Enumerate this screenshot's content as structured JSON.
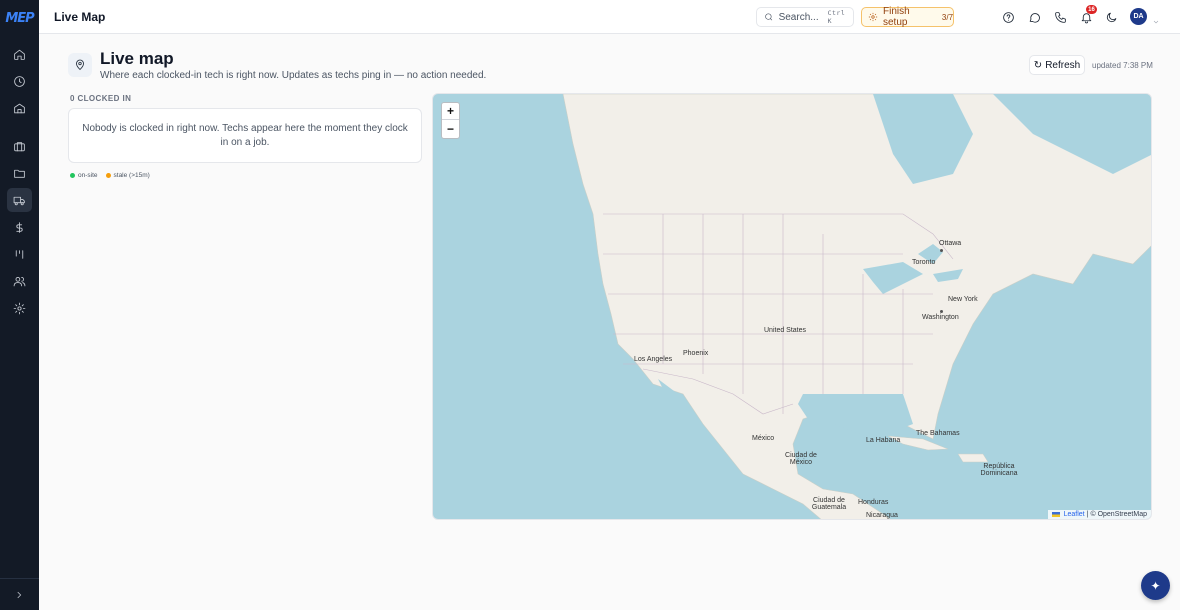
{
  "app": {
    "logo_text": "MEP",
    "title": "Live Map"
  },
  "topbar": {
    "search_placeholder": "Search...",
    "search_shortcut": "Ctrl K",
    "finish_setup_label": "Finish setup",
    "finish_setup_progress": "3/7",
    "notification_count": "16",
    "avatar_initials": "DA"
  },
  "page": {
    "title": "Live map",
    "subtitle": "Where each clocked-in tech is right now. Updates as techs ping in — no action needed.",
    "refresh_label": "Refresh",
    "updated_text": "updated 7:38 PM"
  },
  "clocked": {
    "label": "0 CLOCKED IN",
    "empty_message": "Nobody is clocked in right now. Techs appear here the moment they clock in on a job."
  },
  "legend": [
    {
      "label": "on-site",
      "color": "#22c55e"
    },
    {
      "label": "stale (>15m)",
      "color": "#f59e0b"
    }
  ],
  "map": {
    "zoom_in": "+",
    "zoom_out": "−",
    "attribution_leaflet": "Leaflet",
    "attribution_separator": "|",
    "attribution_osm": "© OpenStreetMap",
    "labels": {
      "ottawa": "Ottawa",
      "toronto": "Toronto",
      "new_york": "New York",
      "washington": "Washington",
      "united_states": "United States",
      "phoenix": "Phoenix",
      "los_angeles": "Los Angeles",
      "la_habana": "La Habana",
      "the_bahamas": "The Bahamas",
      "mexico": "México",
      "ciudad_de_mexico": "Ciudad de México",
      "republica_dominicana": "República Dominicana",
      "honduras": "Honduras",
      "ciudad_de_guatemala": "Ciudad de Guatemala",
      "nicaragua": "Nicaragua"
    },
    "colors": {
      "water": "#aad3df",
      "land": "#f2efe9",
      "border": "#c9b8c9"
    }
  },
  "sidebar": {
    "items": [
      {
        "name": "home-icon"
      },
      {
        "name": "clock-icon"
      },
      {
        "name": "building-icon"
      },
      {
        "name": "briefcase-icon"
      },
      {
        "name": "folder-icon"
      },
      {
        "name": "truck-icon"
      },
      {
        "name": "dollar-icon"
      },
      {
        "name": "kanban-icon"
      },
      {
        "name": "users-icon"
      },
      {
        "name": "gear-icon"
      }
    ]
  }
}
